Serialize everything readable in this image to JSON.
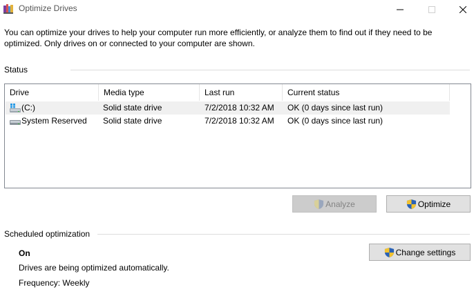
{
  "window": {
    "title": "Optimize Drives",
    "icons": {
      "app": "optimize-drives-icon",
      "minimize": "minimize-icon",
      "maximize": "maximize-icon",
      "close": "close-icon"
    }
  },
  "intro": "You can optimize your drives to help your computer run more efficiently, or analyze them to find out if they need to be optimized. Only drives on or connected to your computer are shown.",
  "status": {
    "label": "Status",
    "columns": [
      "Drive",
      "Media type",
      "Last run",
      "Current status"
    ],
    "drives": [
      {
        "name": "(C:)",
        "icon": "windows-drive-icon",
        "media_type": "Solid state drive",
        "last_run": "7/2/2018 10:32 AM",
        "current_status": "OK (0 days since last run)",
        "selected": true
      },
      {
        "name": "System Reserved",
        "icon": "drive-icon",
        "media_type": "Solid state drive",
        "last_run": "7/2/2018 10:32 AM",
        "current_status": "OK (0 days since last run)",
        "selected": false
      }
    ]
  },
  "buttons": {
    "analyze": {
      "label": "Analyze",
      "enabled": false,
      "icon": "uac-shield-icon"
    },
    "optimize": {
      "label": "Optimize",
      "enabled": true,
      "icon": "uac-shield-icon"
    },
    "change_settings": {
      "label": "Change settings",
      "enabled": true,
      "icon": "uac-shield-icon"
    }
  },
  "scheduled": {
    "label": "Scheduled optimization",
    "state": "On",
    "description": "Drives are being optimized automatically.",
    "frequency": "Frequency: Weekly"
  },
  "colors": {
    "shield_blue": "#2a62b6",
    "shield_yellow": "#f2c230",
    "selected_row": "#f0f0f0",
    "button_face": "#e1e1e1"
  }
}
